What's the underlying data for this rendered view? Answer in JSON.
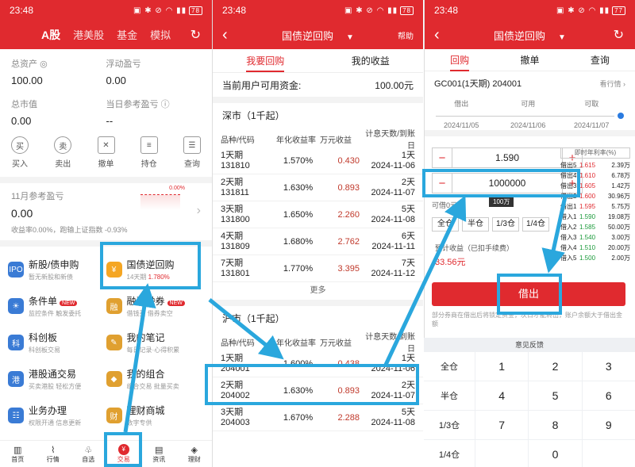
{
  "status": {
    "time": "23:48",
    "battery1": "78",
    "battery2": "78",
    "battery3": "77"
  },
  "p1": {
    "tabs": [
      "A股",
      "港美股",
      "基金",
      "模拟"
    ],
    "assets": [
      {
        "label": "总资产",
        "value": "100.00"
      },
      {
        "label": "浮动盈亏",
        "value": "0.00"
      },
      {
        "label": "总市值",
        "value": "0.00"
      },
      {
        "label": "当日参考盈亏",
        "value": "--"
      }
    ],
    "actions": [
      {
        "label": "买入",
        "glyph": "买"
      },
      {
        "label": "卖出",
        "glyph": "卖"
      },
      {
        "label": "撤单",
        "glyph": "✕"
      },
      {
        "label": "持仓",
        "glyph": "≡"
      },
      {
        "label": "查询",
        "glyph": "☰"
      }
    ],
    "month": {
      "label": "11月参考盈亏",
      "value": "0.00",
      "pct": "0.00%",
      "desc": "收益率0.00%，跑输上证指数 -0.93%"
    },
    "menu": [
      {
        "title": "新股/债申购",
        "sub": "暂无新股和新债",
        "icon": "IPO",
        "color": "#3a7bd5"
      },
      {
        "title": "国债逆回购",
        "sub": "14天期",
        "rate": "1.780%",
        "icon": "¥",
        "color": "#f5a623"
      },
      {
        "title": "条件单",
        "sub": "监控条件 触发委托",
        "badge": "NEW",
        "icon": "☀",
        "color": "#3a7bd5"
      },
      {
        "title": "融资融券",
        "sub": "借钱买 借券卖空",
        "badge": "NEW",
        "icon": "融",
        "color": "#e0a030"
      },
      {
        "title": "科创板",
        "sub": "科创板交易",
        "icon": "科",
        "color": "#3a7bd5"
      },
      {
        "title": "我的笔记",
        "sub": "每日记录·心得积累",
        "icon": "✎",
        "color": "#e0a030"
      },
      {
        "title": "港股通交易",
        "sub": "买卖港股 轻松方便",
        "icon": "港",
        "color": "#3a7bd5"
      },
      {
        "title": "我的组合",
        "sub": "组合交易 批量买卖",
        "icon": "◆",
        "color": "#e0a030"
      },
      {
        "title": "业务办理",
        "sub": "权限开通 信息更新",
        "icon": "☷",
        "color": "#3a7bd5"
      },
      {
        "title": "理财商城",
        "sub": "数字专供",
        "icon": "财",
        "color": "#e0a030"
      }
    ],
    "bottom": [
      "首页",
      "行情",
      "自选",
      "交易",
      "资讯",
      "理财"
    ]
  },
  "p2": {
    "title": "国债逆回购",
    "help": "帮助",
    "tabs": [
      "我要回购",
      "我的收益"
    ],
    "avail_label": "当前用户可用资金:",
    "avail_value": "100.00元",
    "cols": [
      "品种/代码",
      "年化收益率",
      "万元收益",
      "计息天数/到账日"
    ],
    "sz": {
      "title": "深市（1千起）",
      "rows": [
        {
          "name": "1天期",
          "code": "131810",
          "rate": "1.570%",
          "wan": "0.430",
          "days": "1天",
          "date": "2024-11-06"
        },
        {
          "name": "2天期",
          "code": "131811",
          "rate": "1.630%",
          "wan": "0.893",
          "days": "2天",
          "date": "2024-11-07"
        },
        {
          "name": "3天期",
          "code": "131800",
          "rate": "1.650%",
          "wan": "2.260",
          "days": "5天",
          "date": "2024-11-08"
        },
        {
          "name": "4天期",
          "code": "131809",
          "rate": "1.680%",
          "wan": "2.762",
          "days": "6天",
          "date": "2024-11-11"
        },
        {
          "name": "7天期",
          "code": "131801",
          "rate": "1.770%",
          "wan": "3.395",
          "days": "7天",
          "date": "2024-11-12"
        }
      ]
    },
    "more": "更多",
    "sh": {
      "title": "沪市（1千起）",
      "rows": [
        {
          "name": "1天期",
          "code": "204001",
          "rate": "1.600%",
          "wan": "0.438",
          "days": "1天",
          "date": "2024-11-06"
        },
        {
          "name": "2天期",
          "code": "204002",
          "rate": "1.630%",
          "wan": "0.893",
          "days": "2天",
          "date": "2024-11-07"
        },
        {
          "name": "3天期",
          "code": "204003",
          "rate": "1.670%",
          "wan": "2.288",
          "days": "5天",
          "date": "2024-11-08"
        }
      ]
    }
  },
  "p3": {
    "title": "国债逆回购",
    "tabs": [
      "回购",
      "撤单",
      "查询"
    ],
    "product": "GC001(1天期)  204001",
    "view": "看行情",
    "steps": [
      {
        "label": "借出",
        "date": "2024/11/05"
      },
      {
        "label": "可用",
        "date": "2024/11/06"
      },
      {
        "label": "可取",
        "date": "2024/11/07"
      }
    ],
    "price": "1.590",
    "qty": "1000000",
    "tooltip": "100万",
    "avail": "可借0元",
    "rate_header": "即时年利率(%)",
    "rates": [
      {
        "l": "借出5",
        "p": "1.615",
        "q": "2.39万",
        "g": false
      },
      {
        "l": "借出4",
        "p": "1.610",
        "q": "6.78万",
        "g": false
      },
      {
        "l": "借出3",
        "p": "1.605",
        "q": "1.42万",
        "g": false
      },
      {
        "l": "借出2",
        "p": "1.600",
        "q": "30.96万",
        "g": false
      },
      {
        "l": "借出1",
        "p": "1.595",
        "q": "5.75万",
        "g": false
      },
      {
        "l": "借入1",
        "p": "1.590",
        "q": "19.08万",
        "g": true
      },
      {
        "l": "借入2",
        "p": "1.585",
        "q": "50.00万",
        "g": true
      },
      {
        "l": "借入3",
        "p": "1.540",
        "q": "3.00万",
        "g": true
      },
      {
        "l": "借入4",
        "p": "1.510",
        "q": "20.00万",
        "g": true
      },
      {
        "l": "借入5",
        "p": "1.500",
        "q": "2.00万",
        "g": true
      }
    ],
    "positions": [
      "全仓",
      "半仓",
      "1/3仓",
      "1/4仓"
    ],
    "income_label": "预计收益（已扣手续费）",
    "income_value": "33.56元",
    "lend": "借出",
    "note": "部分券商在借出后将锁定资金，次日才能转出，账户余额大于借出金额",
    "kb_title": "意见反馈",
    "keys": [
      "全仓",
      "1",
      "2",
      "3",
      "半仓",
      "4",
      "5",
      "6",
      "1/3仓",
      "7",
      "8",
      "9",
      "1/4仓",
      "",
      "0",
      ""
    ]
  }
}
